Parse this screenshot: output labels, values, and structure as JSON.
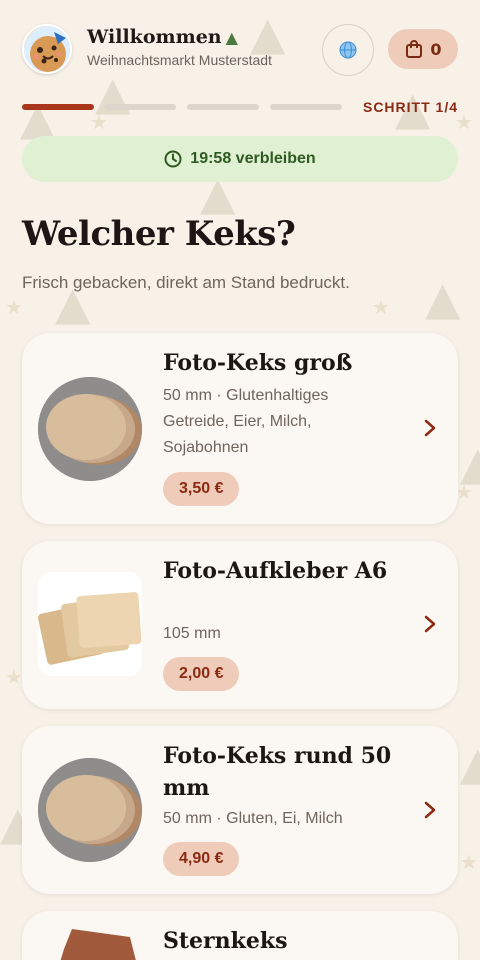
{
  "header": {
    "title": "Willkommen",
    "subtitle": "Weihnachtsmarkt Musterstadt",
    "language_icon": "globe-icon",
    "cart_count": "0"
  },
  "progress": {
    "step_label": "SCHRITT 1/4",
    "total_steps": 4,
    "current_step": 1
  },
  "timer": {
    "text": "19:58 verbleiben"
  },
  "page": {
    "heading": "Welcher Keks?",
    "lead": "Frisch gebacken, direkt am Stand bedruckt."
  },
  "products": [
    {
      "title": "Foto-Keks groß",
      "description": "50 mm · Glutenhaltiges Getreide, Eier, Milch, Sojabohnen",
      "price": "3,50 €"
    },
    {
      "title": "Foto-Aufkleber A6",
      "description": "105 mm",
      "price": "2,00 €"
    },
    {
      "title": "Foto-Keks rund 50 mm",
      "description": "50 mm · Gluten, Ei, Milch",
      "price": "4,90 €"
    },
    {
      "title": "Sternkeks",
      "description": "",
      "price": ""
    }
  ],
  "colors": {
    "background": "#f7f1e8",
    "accent": "#a9361a",
    "price_bg": "#efcbb9",
    "timer_bg": "#dff0d3"
  }
}
